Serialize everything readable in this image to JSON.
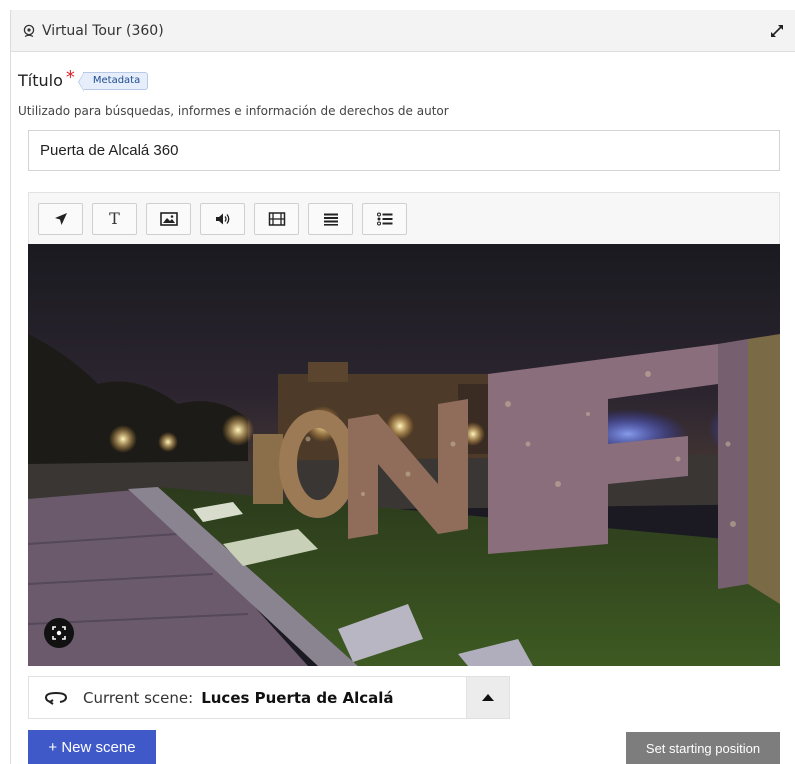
{
  "panel": {
    "title": "Virtual Tour (360)",
    "title_icon": "virtual-tour-icon",
    "expand_icon": "expand-icon"
  },
  "field": {
    "label": "Título",
    "required_mark": "*",
    "badge": "Metadata",
    "description": "Utilizado para búsquedas, informes e información de derechos de autor",
    "value": "Puerta de Alcalá 360"
  },
  "toolbar": {
    "tools": [
      {
        "icon": "navigation-arrow-icon",
        "name": "go-to-scene"
      },
      {
        "icon": "text-icon",
        "name": "text",
        "glyph": "T"
      },
      {
        "icon": "image-icon",
        "name": "image"
      },
      {
        "icon": "audio-icon",
        "name": "audio"
      },
      {
        "icon": "video-icon",
        "name": "video"
      },
      {
        "icon": "summary-icon",
        "name": "summary"
      },
      {
        "icon": "list-icon",
        "name": "list"
      }
    ]
  },
  "viewer": {
    "image_description": "360 panorama of illuminated letter sculptures near Puerta de Alcalá at night",
    "recenter_icon": "recenter-icon"
  },
  "scene": {
    "prefix": "Current scene:",
    "name": "Luces Puerta de Alcalá",
    "icon": "scene-loop-icon",
    "toggle_icon": "caret-up-icon"
  },
  "buttons": {
    "new_scene": "+ New scene",
    "set_start": "Set starting position"
  },
  "colors": {
    "primary": "#3f59c9",
    "secondary": "#7d7d7d",
    "required": "#d9222a"
  }
}
